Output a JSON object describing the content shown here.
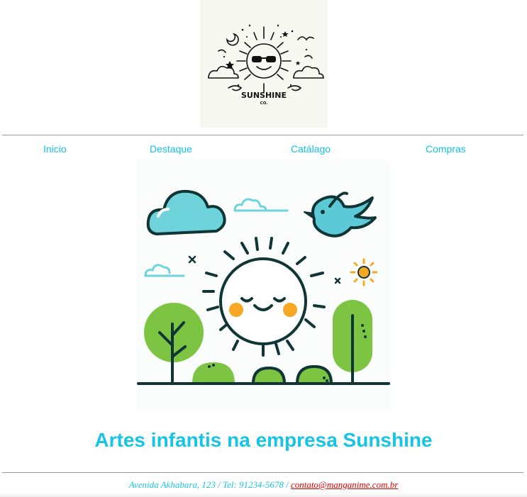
{
  "logo": {
    "name": "SUNSHINE",
    "suffix": "CO."
  },
  "nav": {
    "items": [
      {
        "label": "Inicio"
      },
      {
        "label": "Destaque"
      },
      {
        "label": "Catálago"
      },
      {
        "label": "Compras"
      }
    ],
    "color": "#13c3e3"
  },
  "hero": {
    "alt": ""
  },
  "headline": "Artes infantis na empresa Sunshine",
  "footer": {
    "address": "Avenida Akhabara, 123 / Tel: 91234-5678 /",
    "email": "contato@manganime.com.br",
    "link_color": "#e00000"
  },
  "colors": {
    "accent": "#17c4e6",
    "cloud": "#6fd3dc",
    "tree": "#7cc442",
    "cheek": "#f8a723",
    "outline": "#0f3535"
  }
}
